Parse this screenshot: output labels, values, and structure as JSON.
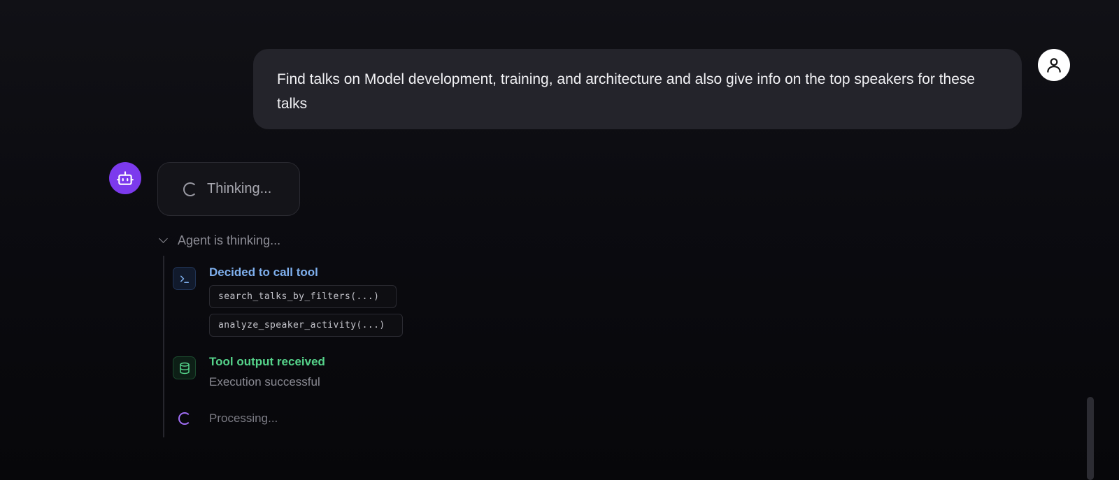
{
  "user_message": {
    "text": "Find talks on Model development, training, and architecture and also give info on the top speakers for these talks",
    "avatar_icon": "user-icon"
  },
  "assistant": {
    "avatar_icon": "robot-icon",
    "accent_color": "#7c3aed",
    "status_label": "Thinking..."
  },
  "trace": {
    "header_label": "Agent is thinking...",
    "steps": [
      {
        "icon": "terminal-icon",
        "title": "Decided to call tool",
        "title_color": "#7fb0ee",
        "calls": [
          "search_talks_by_filters(...)",
          "analyze_speaker_activity(...)"
        ]
      },
      {
        "icon": "database-icon",
        "title": "Tool output received",
        "title_color": "#55d38a",
        "description": "Execution successful"
      },
      {
        "icon": "spinner-icon",
        "label": "Processing...",
        "spinner_color": "#a16ef5"
      }
    ]
  }
}
